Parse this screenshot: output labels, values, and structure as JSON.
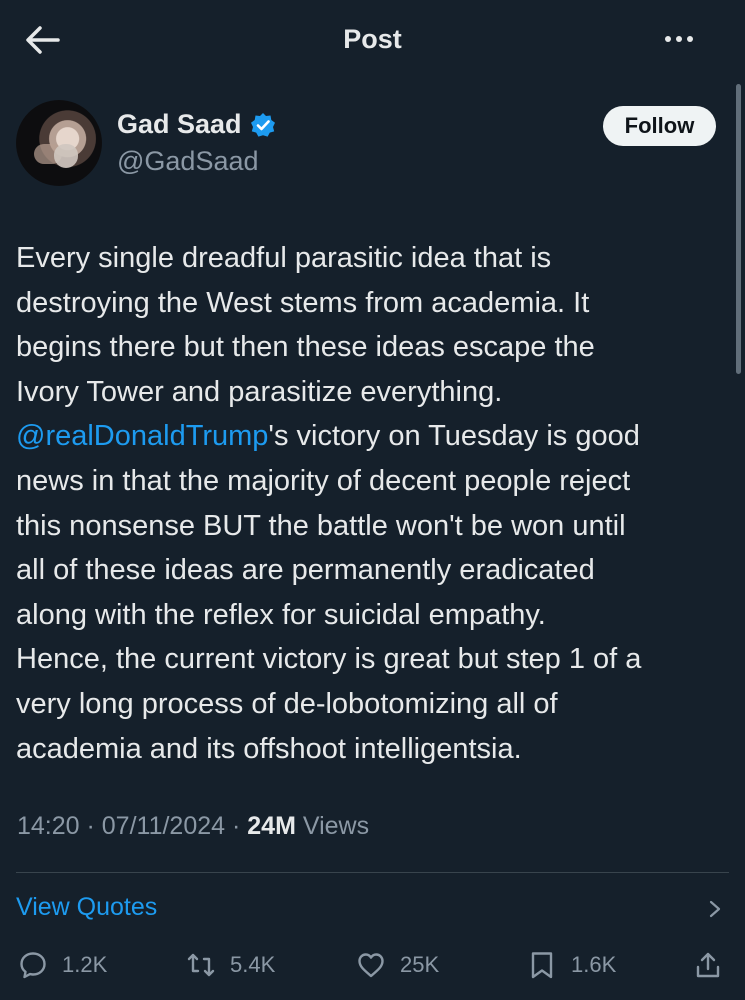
{
  "header": {
    "title": "Post"
  },
  "author": {
    "name": "Gad Saad",
    "handle": "@GadSaad"
  },
  "follow_label": "Follow",
  "tweet": {
    "line1": "Every single dreadful parasitic idea that is",
    "line2": "destroying the West stems from academia.  It",
    "line3": "begins there but then these ideas escape the",
    "line4": "Ivory Tower and parasitize everything.",
    "mention": "@realDonaldTrump",
    "line5_rest": "'s victory on Tuesday is good",
    "line6": "news in that the majority of decent people reject",
    "line7": "this nonsense BUT the battle won't be won until",
    "line8": "all of these ideas are permanently eradicated",
    "line9": "along with the reflex for suicidal empathy.",
    "line10": "Hence, the current victory is great but step 1 of a",
    "line11": "very long process of de-lobotomizing all of",
    "line12": "academia and its offshoot intelligentsia."
  },
  "meta": {
    "time": "14:20",
    "sep1": " · ",
    "date": "07/11/2024",
    "sep2": " · ",
    "views_count": "24M",
    "views_label": " Views"
  },
  "view_quotes": "View Quotes",
  "actions": {
    "replies": "1.2K",
    "reposts": "5.4K",
    "likes": "25K",
    "bookmarks": "1.6K"
  },
  "colors": {
    "background": "#15202b",
    "accent": "#1d9bf0",
    "muted": "#8b98a5"
  }
}
